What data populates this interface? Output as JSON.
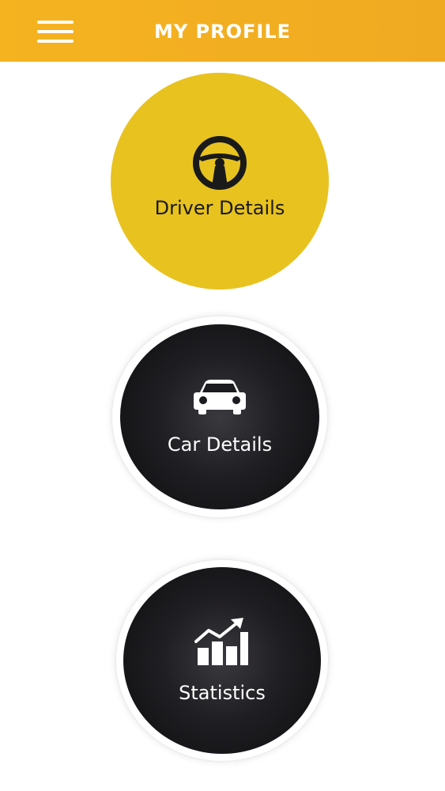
{
  "header": {
    "title": "MY PROFILE",
    "menu_icon": "hamburger-menu-icon",
    "background_color": "#f2ad21"
  },
  "menu": {
    "driver_details": {
      "label": "Driver Details",
      "icon": "steering-wheel-icon",
      "background_color": "#e8c21f"
    },
    "car_details": {
      "label": "Car Details",
      "icon": "car-icon",
      "background_color": "#151417"
    },
    "statistics": {
      "label": "Statistics",
      "icon": "chart-growth-icon",
      "background_color": "#151417"
    }
  }
}
